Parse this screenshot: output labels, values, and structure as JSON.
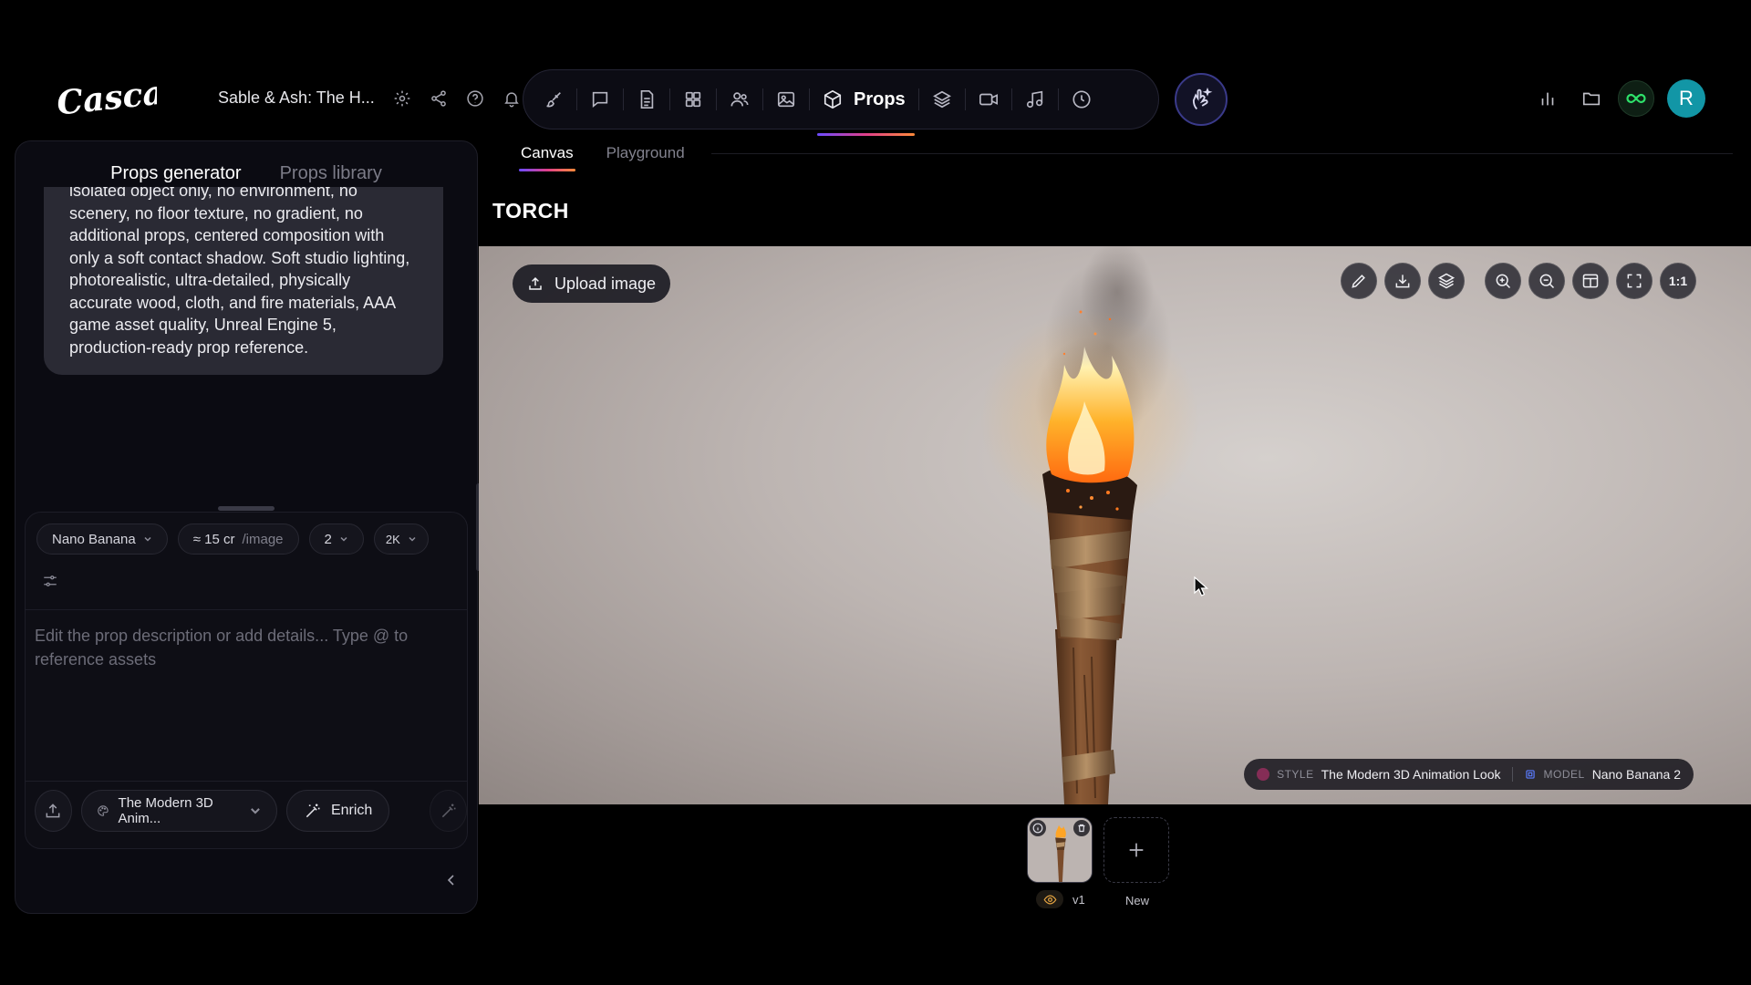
{
  "app": {
    "name": "Cascade"
  },
  "project": {
    "title": "Sable & Ash: The H..."
  },
  "nav": {
    "items": [
      {
        "name": "brush",
        "label": ""
      },
      {
        "name": "chat",
        "label": ""
      },
      {
        "name": "document",
        "label": ""
      },
      {
        "name": "grid",
        "label": ""
      },
      {
        "name": "characters",
        "label": ""
      },
      {
        "name": "image",
        "label": ""
      },
      {
        "name": "props",
        "label": "Props",
        "active": true
      },
      {
        "name": "layers",
        "label": ""
      },
      {
        "name": "video",
        "label": ""
      },
      {
        "name": "music",
        "label": ""
      },
      {
        "name": "history",
        "label": ""
      }
    ]
  },
  "user": {
    "avatar_letter": "R"
  },
  "left_panel": {
    "tabs": [
      {
        "label": "Props generator",
        "active": true
      },
      {
        "label": "Props library",
        "active": false
      }
    ],
    "prompt_message": "isolated object only, no environment, no scenery, no floor texture, no gradient, no additional props, centered composition with only a soft contact shadow. Soft studio lighting, photorealistic, ultra-detailed, physically accurate wood, cloth, and fire materials, AAA game asset quality, Unreal Engine 5, production-ready prop reference.",
    "composer": {
      "model": "Nano Banana",
      "cost_amount": "≈ 15 cr",
      "cost_unit": "/image",
      "count": "2",
      "resolution": "2K",
      "placeholder": "Edit the prop description or add details... Type @ to reference assets",
      "style": "The Modern 3D Anim...",
      "enrich_label": "Enrich"
    }
  },
  "main": {
    "tabs": [
      {
        "label": "Canvas",
        "active": true
      },
      {
        "label": "Playground",
        "active": false
      }
    ],
    "title": "TORCH",
    "upload_label": "Upload image",
    "zoom_reset_label": "1:1",
    "meta": {
      "style_key": "STYLE",
      "style_value": "The Modern 3D Animation Look",
      "model_key": "MODEL",
      "model_value": "Nano Banana 2"
    }
  },
  "versions": {
    "items": [
      {
        "label": "v1"
      }
    ],
    "new_label": "New"
  },
  "colors": {
    "accent_gradient": [
      "#6c4bff",
      "#e0408a",
      "#ff8a3a"
    ],
    "infinity_green": "#2ee06a",
    "avatar_teal": "#1296a6"
  }
}
